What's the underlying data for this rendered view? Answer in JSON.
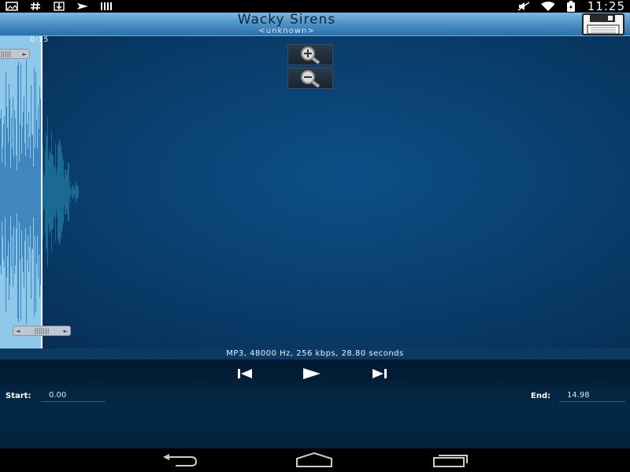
{
  "status_bar": {
    "time": "11:25",
    "left_icons": [
      "gallery-icon",
      "hash-icon",
      "download-icon",
      "send-icon",
      "barcode-icon"
    ],
    "right_icons": [
      "mute-icon",
      "wifi-icon",
      "battery-icon"
    ]
  },
  "header": {
    "title": "Wacky Sirens",
    "subtitle": "<unknown>",
    "save_icon": "floppy-disk-icon"
  },
  "waveform": {
    "time_marker": "0:15",
    "zoom_in_icon": "zoom-in-icon",
    "zoom_out_icon": "zoom-out-icon"
  },
  "info": {
    "text": "MP3, 48000 Hz, 256 kbps, 28.80 seconds"
  },
  "controls": {
    "prev_icon": "skip-previous-icon",
    "play_icon": "play-icon",
    "next_icon": "skip-next-icon"
  },
  "range": {
    "start_label": "Start:",
    "start_value": "0.00",
    "end_label": "End:",
    "end_value": "14.98"
  },
  "nav_bar": {
    "back_icon": "back-icon",
    "home_icon": "home-icon",
    "recents_icon": "recents-icon"
  },
  "colors": {
    "title_bar": "#4f95c8",
    "background": "#0a3f6e",
    "selection": "#8ec9ec"
  }
}
